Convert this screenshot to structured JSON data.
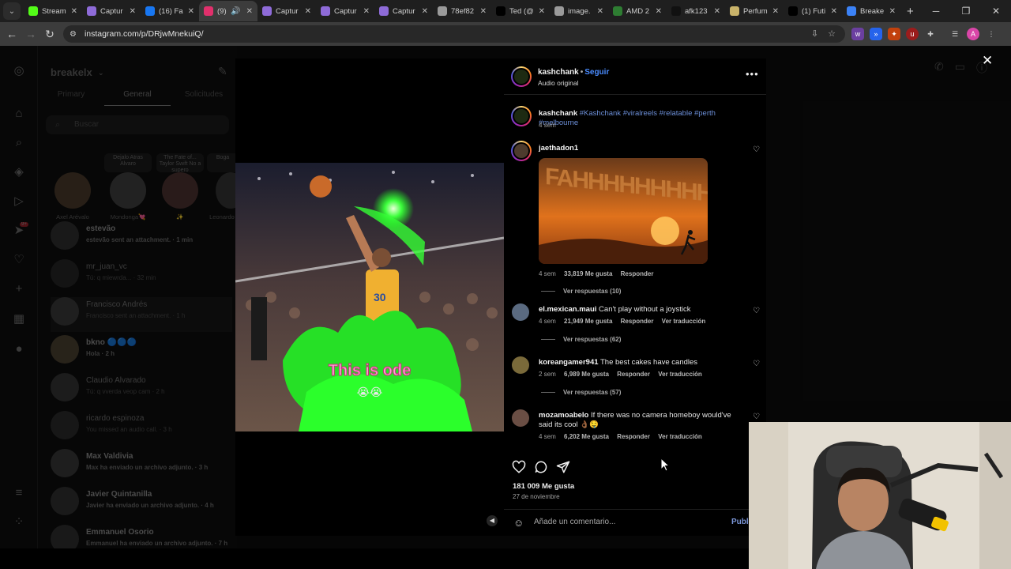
{
  "browser": {
    "tabs": [
      {
        "label": "Stream",
        "fav": "kick-icon",
        "color": "#53fc18"
      },
      {
        "label": "Captur",
        "fav": "pen-icon",
        "color": "#8e6bd8"
      },
      {
        "label": "(16) Fa",
        "fav": "facebook-icon",
        "color": "#1877f2"
      },
      {
        "label": "(9)",
        "fav": "instagram-icon",
        "color": "#e1306c",
        "active": true
      },
      {
        "label": "Captur",
        "fav": "pen-icon",
        "color": "#8e6bd8"
      },
      {
        "label": "Captur",
        "fav": "pen-icon",
        "color": "#8e6bd8"
      },
      {
        "label": "Captur",
        "fav": "pen-icon",
        "color": "#8e6bd8"
      },
      {
        "label": "78ef82",
        "fav": "openai-icon",
        "color": "#9a9a9a"
      },
      {
        "label": "Ted (@",
        "fav": "x-icon",
        "color": "#000000"
      },
      {
        "label": "image.",
        "fav": "globe-icon",
        "color": "#9a9a9a"
      },
      {
        "label": "AMD 2",
        "fav": "chart-icon",
        "color": "#2e7d32"
      },
      {
        "label": "afk123",
        "fav": "tiktok-icon",
        "color": "#111111"
      },
      {
        "label": "Perfum",
        "fav": "perfume-icon",
        "color": "#c9b36a"
      },
      {
        "label": "(1) Futi",
        "fav": "x-icon",
        "color": "#000000"
      },
      {
        "label": "Breake",
        "fav": "breakex-icon",
        "color": "#3b82f6"
      }
    ],
    "url": "instagram.com/p/DRjwMnekuiQ/"
  },
  "dm": {
    "username": "breakelx",
    "tabs": [
      "Primary",
      "General",
      "Solicitudes"
    ],
    "search_placeholder": "Buscar",
    "notes": [
      {
        "bubble": "",
        "name": "Axel Arévalo"
      },
      {
        "bubble": "Dejalo Atras Alvaro",
        "name": "Mondonga💘"
      },
      {
        "bubble": "The Fate of... Taylor Swift No a supero",
        "name": "✨"
      },
      {
        "bubble": "Boga",
        "name": "Leonardo"
      }
    ],
    "chats": [
      {
        "name": "estevão",
        "preview": "estevão sent an attachment. · 1 min",
        "bold": true
      },
      {
        "name": "mr_juan_vc",
        "preview": "Tú: q miewrda... · 32 min",
        "bold": false
      },
      {
        "name": "Francisco Andrés",
        "preview": "Francisco sent an attachment. · 1 h",
        "bold": false
      },
      {
        "name": "bkno 🔵🔵🔵",
        "preview": "Hola · 2 h",
        "bold": true
      },
      {
        "name": "Claudio Alvarado",
        "preview": "Tú: q vverda veop cam · 2 h",
        "bold": false
      },
      {
        "name": "ricardo espinoza",
        "preview": "You missed an audio call. · 3 h",
        "bold": false
      },
      {
        "name": "Max Valdivia",
        "preview": "Max ha enviado un archivo adjunto. · 3 h",
        "bold": true
      },
      {
        "name": "Javier Quintanilla",
        "preview": "Javier ha enviado un archivo adjunto. · 4 h",
        "bold": true
      },
      {
        "name": "Emmanuel Osorio",
        "preview": "Emmanuel ha enviado un archivo adjunto. · 7 h",
        "bold": true
      }
    ],
    "badge": "9+"
  },
  "post": {
    "author": "kashchank",
    "follow": "Seguir",
    "audio": "Audio original",
    "video_caption": "This is ode",
    "caption": {
      "user": "kashchank",
      "tags": "#Kashchank #viralreels #relatable #perth #melbourne",
      "time": "4 sem"
    },
    "comments": [
      {
        "user": "jaethadon1",
        "text": "",
        "time": "4 sem",
        "likes": "33,819 Me gusta",
        "reply": "Responder",
        "translate": "",
        "replies": "Ver respuestas (10)",
        "gif_text": "FAHHHHHHHHH"
      },
      {
        "user": "el.mexican.maui",
        "text": "Can't play without a joystick",
        "time": "4 sem",
        "likes": "21,949 Me gusta",
        "reply": "Responder",
        "translate": "Ver traducción",
        "replies": "Ver respuestas (62)"
      },
      {
        "user": "koreangamer941",
        "text": "The best cakes have candles",
        "time": "2 sem",
        "likes": "6,989 Me gusta",
        "reply": "Responder",
        "translate": "Ver traducción",
        "replies": "Ver respuestas (57)"
      },
      {
        "user": "mozamoabelo",
        "text": "If there was no camera homeboy would've said its cool 👌🏾🤤",
        "time": "4 sem",
        "likes": "6,202 Me gusta",
        "reply": "Responder",
        "translate": "Ver traducción",
        "replies": ""
      }
    ],
    "likes_total": "181 009 Me gusta",
    "date": "27 de noviembre",
    "add_comment_placeholder": "Añade un comentario...",
    "publish": "Publi"
  },
  "colors": {
    "accent": "#4a8cff",
    "tag": "#6c8fd8",
    "like_red": "#ff3040"
  }
}
